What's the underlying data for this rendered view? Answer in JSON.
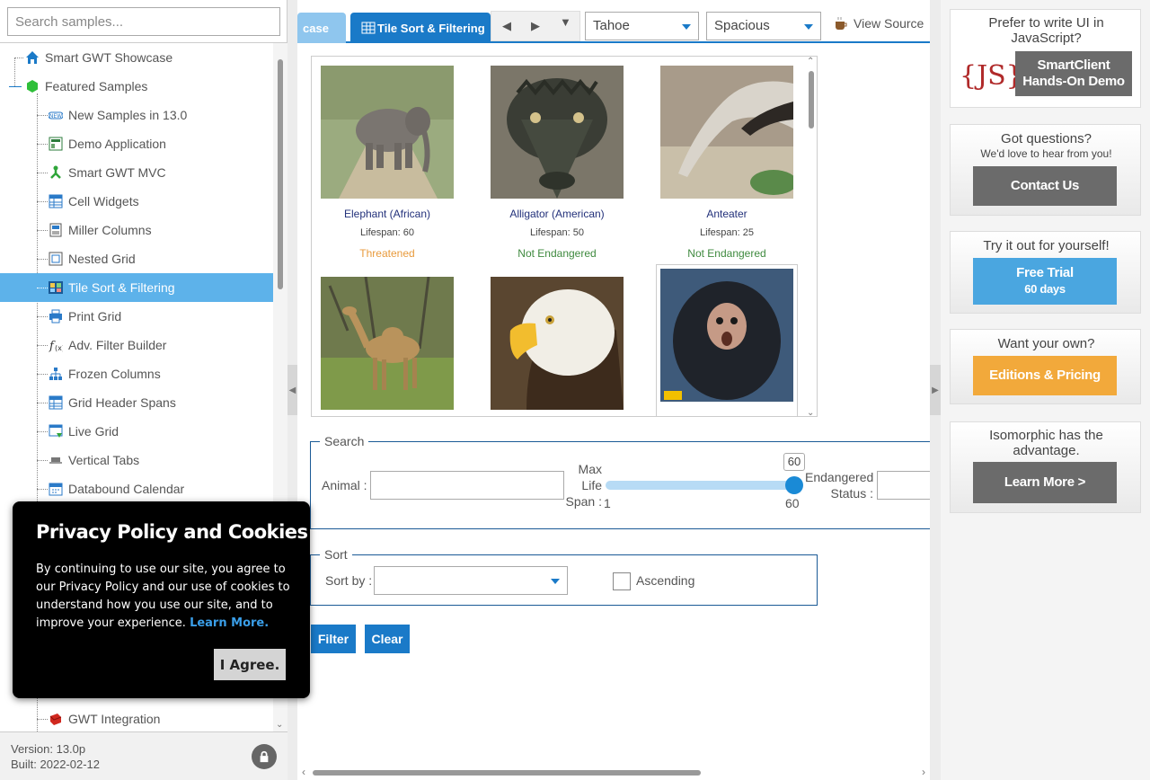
{
  "search": {
    "placeholder": "Search samples..."
  },
  "tree": {
    "items": [
      {
        "label": "Smart GWT Showcase",
        "icon": "home-icon",
        "level": 0
      },
      {
        "label": "Featured Samples",
        "icon": "cube-icon",
        "level": 0
      },
      {
        "label": "New Samples in 13.0",
        "icon": "new-icon",
        "level": 1
      },
      {
        "label": "Demo Application",
        "icon": "app-icon",
        "level": 1
      },
      {
        "label": "Smart GWT MVC",
        "icon": "mvc-icon",
        "level": 1
      },
      {
        "label": "Cell Widgets",
        "icon": "grid-icon",
        "level": 1
      },
      {
        "label": "Miller Columns",
        "icon": "columns-icon",
        "level": 1
      },
      {
        "label": "Nested Grid",
        "icon": "nested-grid-icon",
        "level": 1
      },
      {
        "label": "Tile Sort & Filtering",
        "icon": "tiles-icon",
        "level": 1,
        "selected": true
      },
      {
        "label": "Print Grid",
        "icon": "printer-icon",
        "level": 1
      },
      {
        "label": "Adv. Filter Builder",
        "icon": "function-icon",
        "level": 1
      },
      {
        "label": "Frozen Columns",
        "icon": "hierarchy-icon",
        "level": 1
      },
      {
        "label": "Grid Header Spans",
        "icon": "grid-icon",
        "level": 1
      },
      {
        "label": "Live Grid",
        "icon": "live-grid-icon",
        "level": 1
      },
      {
        "label": "Vertical Tabs",
        "icon": "tabs-icon",
        "level": 1
      },
      {
        "label": "Databound Calendar",
        "icon": "calendar-icon",
        "level": 1
      }
    ],
    "bottom_item": {
      "label": "GWT Integration",
      "icon": "gwt-icon"
    }
  },
  "footer": {
    "version": "Version: 13.0p",
    "built": "Built: 2022-02-12"
  },
  "tabs": {
    "prev_label": "case",
    "active_label": "Tile Sort & Filtering"
  },
  "skin_select": {
    "value": "Tahoe"
  },
  "density_select": {
    "value": "Spacious"
  },
  "view_source": "View Source",
  "tiles": [
    {
      "name": "Elephant (African)",
      "lifespan": "Lifespan: 60",
      "status": "Threatened",
      "status_color": "#e89a3c",
      "image": "elephant"
    },
    {
      "name": "Alligator (American)",
      "lifespan": "Lifespan: 50",
      "status": "Not Endangered",
      "status_color": "#3f8a3f",
      "image": "alligator"
    },
    {
      "name": "Anteater",
      "lifespan": "Lifespan: 25",
      "status": "Not Endangered",
      "status_color": "#3f8a3f",
      "image": "anteater"
    },
    {
      "name": "",
      "lifespan": "",
      "status": "",
      "image": "camel"
    },
    {
      "name": "",
      "lifespan": "",
      "status": "",
      "image": "eagle"
    },
    {
      "name": "",
      "lifespan": "",
      "status": "",
      "image": "monkey"
    }
  ],
  "search_form": {
    "legend": "Search",
    "animal_label": "Animal :",
    "lifespan_label_1": "Max",
    "lifespan_label_2": "Life",
    "lifespan_label_3": "Span :",
    "slider_min": "1",
    "slider_max": "60",
    "slider_value": "60",
    "status_label_1": "Endangered",
    "status_label_2": "Status :"
  },
  "sort_form": {
    "legend": "Sort",
    "sortby_label": "Sort by :",
    "ascending_label": "Ascending"
  },
  "buttons": {
    "filter": "Filter",
    "clear": "Clear"
  },
  "promos": [
    {
      "text": "Prefer to write UI in JavaScript?",
      "button": "SmartClient Hands-On Demo",
      "color": "#6b6b6b"
    },
    {
      "text": "Got questions?",
      "subtext": "We'd love to hear from you!",
      "button": "Contact Us",
      "color": "#6b6b6b"
    },
    {
      "text": "Try it out for yourself!",
      "button": "Free Trial",
      "button2": "60 days",
      "color": "#4aa6e0"
    },
    {
      "text": "Want your own?",
      "button": "Editions & Pricing",
      "color": "#f2a93b"
    },
    {
      "text": "Isomorphic has the advantage.",
      "button": "Learn More >",
      "color": "#6b6b6b"
    }
  ],
  "js_logo": "{JS}",
  "cookie": {
    "title": "Privacy Policy and Cookies",
    "body": "By continuing to use our site, you agree to our Privacy Policy and our use of cookies to understand how you use our site, and to improve your experience.",
    "link": "Learn More.",
    "agree": "I Agree."
  }
}
